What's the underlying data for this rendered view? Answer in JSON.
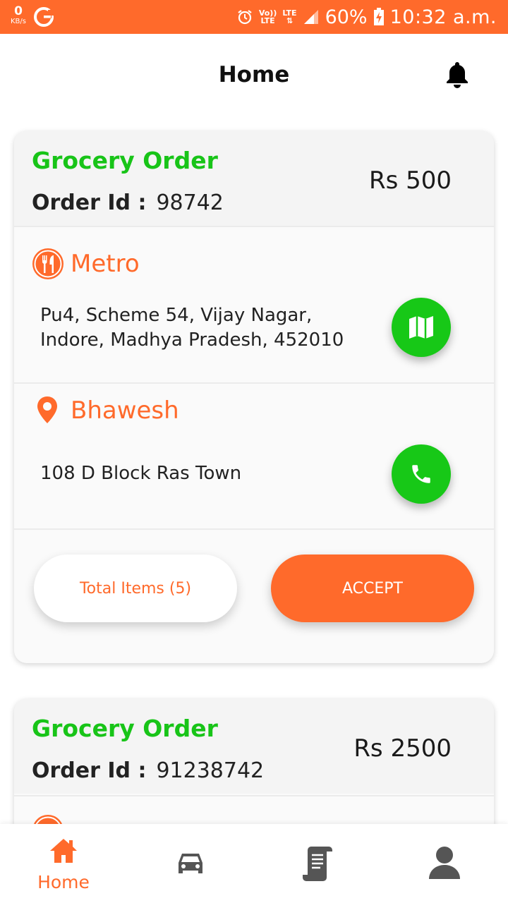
{
  "status_bar": {
    "speed_value": "0",
    "speed_unit": "KB/s",
    "volte_top": "Vo))",
    "volte_bottom": "LTE",
    "lte_label": "LTE",
    "battery_percent": "60%",
    "time": "10:32 a.m."
  },
  "header": {
    "title": "Home"
  },
  "orders": [
    {
      "type": "Grocery Order",
      "id_label": "Order Id :",
      "id_value": "98742",
      "price": "Rs 500",
      "store_name": "Metro",
      "store_address": "Pu4, Scheme 54, Vijay Nagar, Indore, Madhya Pradesh, 452010",
      "customer_name": "Bhawesh",
      "customer_address": "108 D Block Ras Town",
      "items_label": "Total Items (5)",
      "accept_label": "ACCEPT"
    },
    {
      "type": "Grocery Order",
      "id_label": "Order Id :",
      "id_value": "91238742",
      "price": "Rs 2500"
    }
  ],
  "bottom_nav": {
    "home_label": "Home",
    "active_tab": "home"
  },
  "colors": {
    "accent": "#ff6a2b",
    "green": "#17c817",
    "nav_inactive": "#555555"
  },
  "icons": [
    "kbps-indicator",
    "google-icon",
    "alarm-icon",
    "signal-icon",
    "battery-icon",
    "bell-icon",
    "restaurant-icon",
    "map-icon",
    "location-pin-icon",
    "phone-icon",
    "home-icon",
    "car-icon",
    "receipt-icon",
    "profile-icon"
  ]
}
